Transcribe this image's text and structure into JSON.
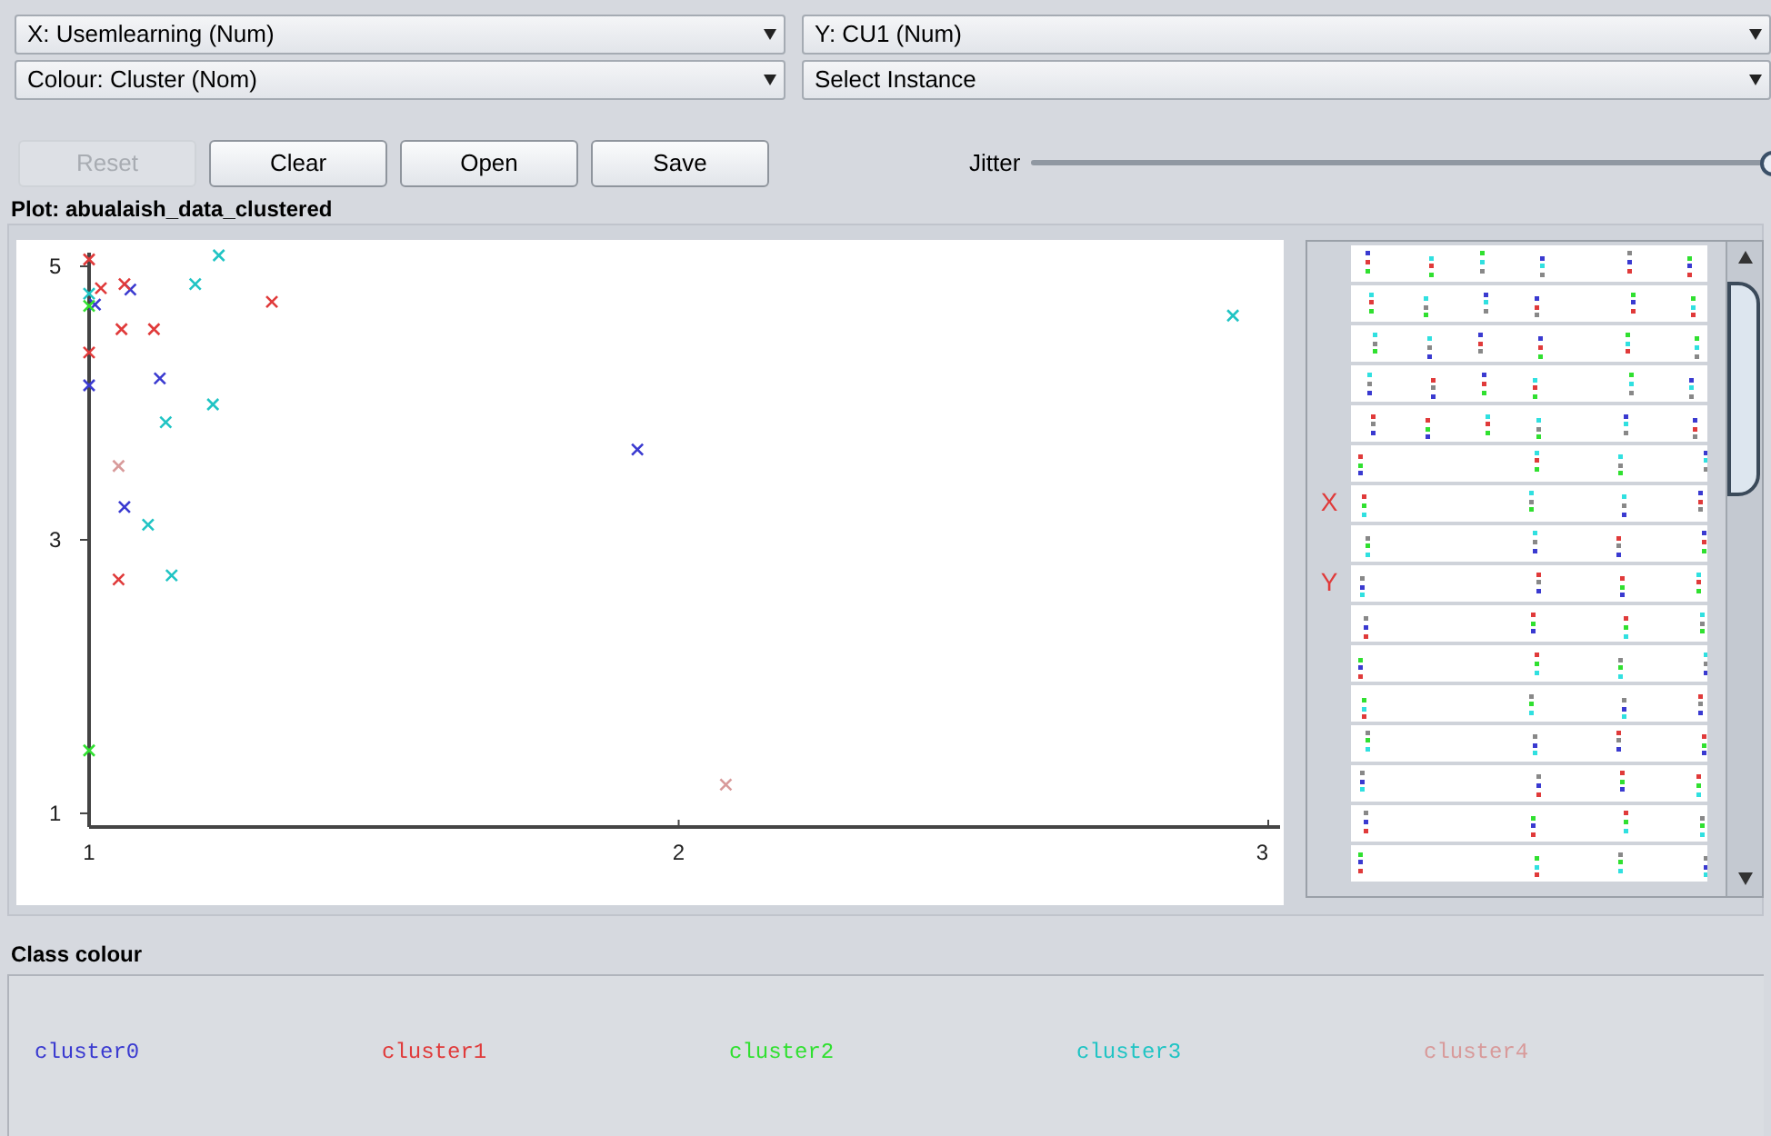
{
  "x_axis_select": {
    "value": "X: Usemlearning (Num)"
  },
  "y_axis_select": {
    "value": "Y: CU1 (Num)"
  },
  "colour_select": {
    "value": "Colour: Cluster (Nom)"
  },
  "instance_select": {
    "value": "Select Instance"
  },
  "buttons": [
    {
      "label": "Reset",
      "disabled": true
    },
    {
      "label": "Clear",
      "disabled": false
    },
    {
      "label": "Open",
      "disabled": false
    },
    {
      "label": "Save",
      "disabled": false
    }
  ],
  "jitter": {
    "label": "Jitter",
    "level": 1
  },
  "plot": {
    "title": "Plot: abualaish_data_clustered",
    "chart_data": {
      "type": "scatter",
      "xlim": [
        1,
        3.02
      ],
      "ylim": [
        0.9,
        5.1
      ],
      "xticks": [
        1,
        2,
        3
      ],
      "yticks": [
        1,
        3,
        5
      ],
      "series": [
        {
          "name": "cluster0",
          "color": "#3a3ad0",
          "x": [
            1.01,
            1.07,
            1.12,
            1.0,
            1.93,
            1.06
          ],
          "values": [
            4.72,
            4.83,
            4.18,
            4.13,
            3.66,
            3.24
          ]
        },
        {
          "name": "cluster1",
          "color": "#e03a3a",
          "x": [
            1.0,
            1.06,
            1.055,
            1.11,
            1.31,
            1.0,
            1.05,
            1.02
          ],
          "values": [
            5.05,
            4.87,
            4.54,
            4.54,
            4.74,
            4.37,
            2.71,
            4.84
          ]
        },
        {
          "name": "cluster2",
          "color": "#30e030",
          "x": [
            1.0,
            1.0
          ],
          "values": [
            1.46,
            4.71
          ]
        },
        {
          "name": "cluster3",
          "color": "#20c4c4",
          "x": [
            1.22,
            1.18,
            1.13,
            1.21,
            1.1,
            1.14,
            2.94,
            1.0
          ],
          "values": [
            5.08,
            4.87,
            3.86,
            3.99,
            3.11,
            2.74,
            4.64,
            4.8
          ]
        },
        {
          "name": "cluster4",
          "color": "#d89a9a",
          "x": [
            1.05,
            2.08
          ],
          "values": [
            3.54,
            1.21
          ]
        }
      ]
    }
  },
  "attribute_strips": {
    "strips": [
      {
        "kind": "plain"
      },
      {
        "kind": "plain"
      },
      {
        "kind": "plain"
      },
      {
        "kind": "plain"
      },
      {
        "kind": "plain"
      },
      {
        "kind": "plain"
      },
      {
        "kind": "marked",
        "marker": "X"
      },
      {
        "kind": "plain"
      },
      {
        "kind": "marked",
        "marker": "Y"
      },
      {
        "kind": "plain"
      },
      {
        "kind": "plain"
      },
      {
        "kind": "plain"
      },
      {
        "kind": "plain"
      },
      {
        "kind": "plain"
      },
      {
        "kind": "plain"
      },
      {
        "kind": "plain"
      }
    ]
  },
  "class_colour": {
    "title": "Class colour"
  }
}
